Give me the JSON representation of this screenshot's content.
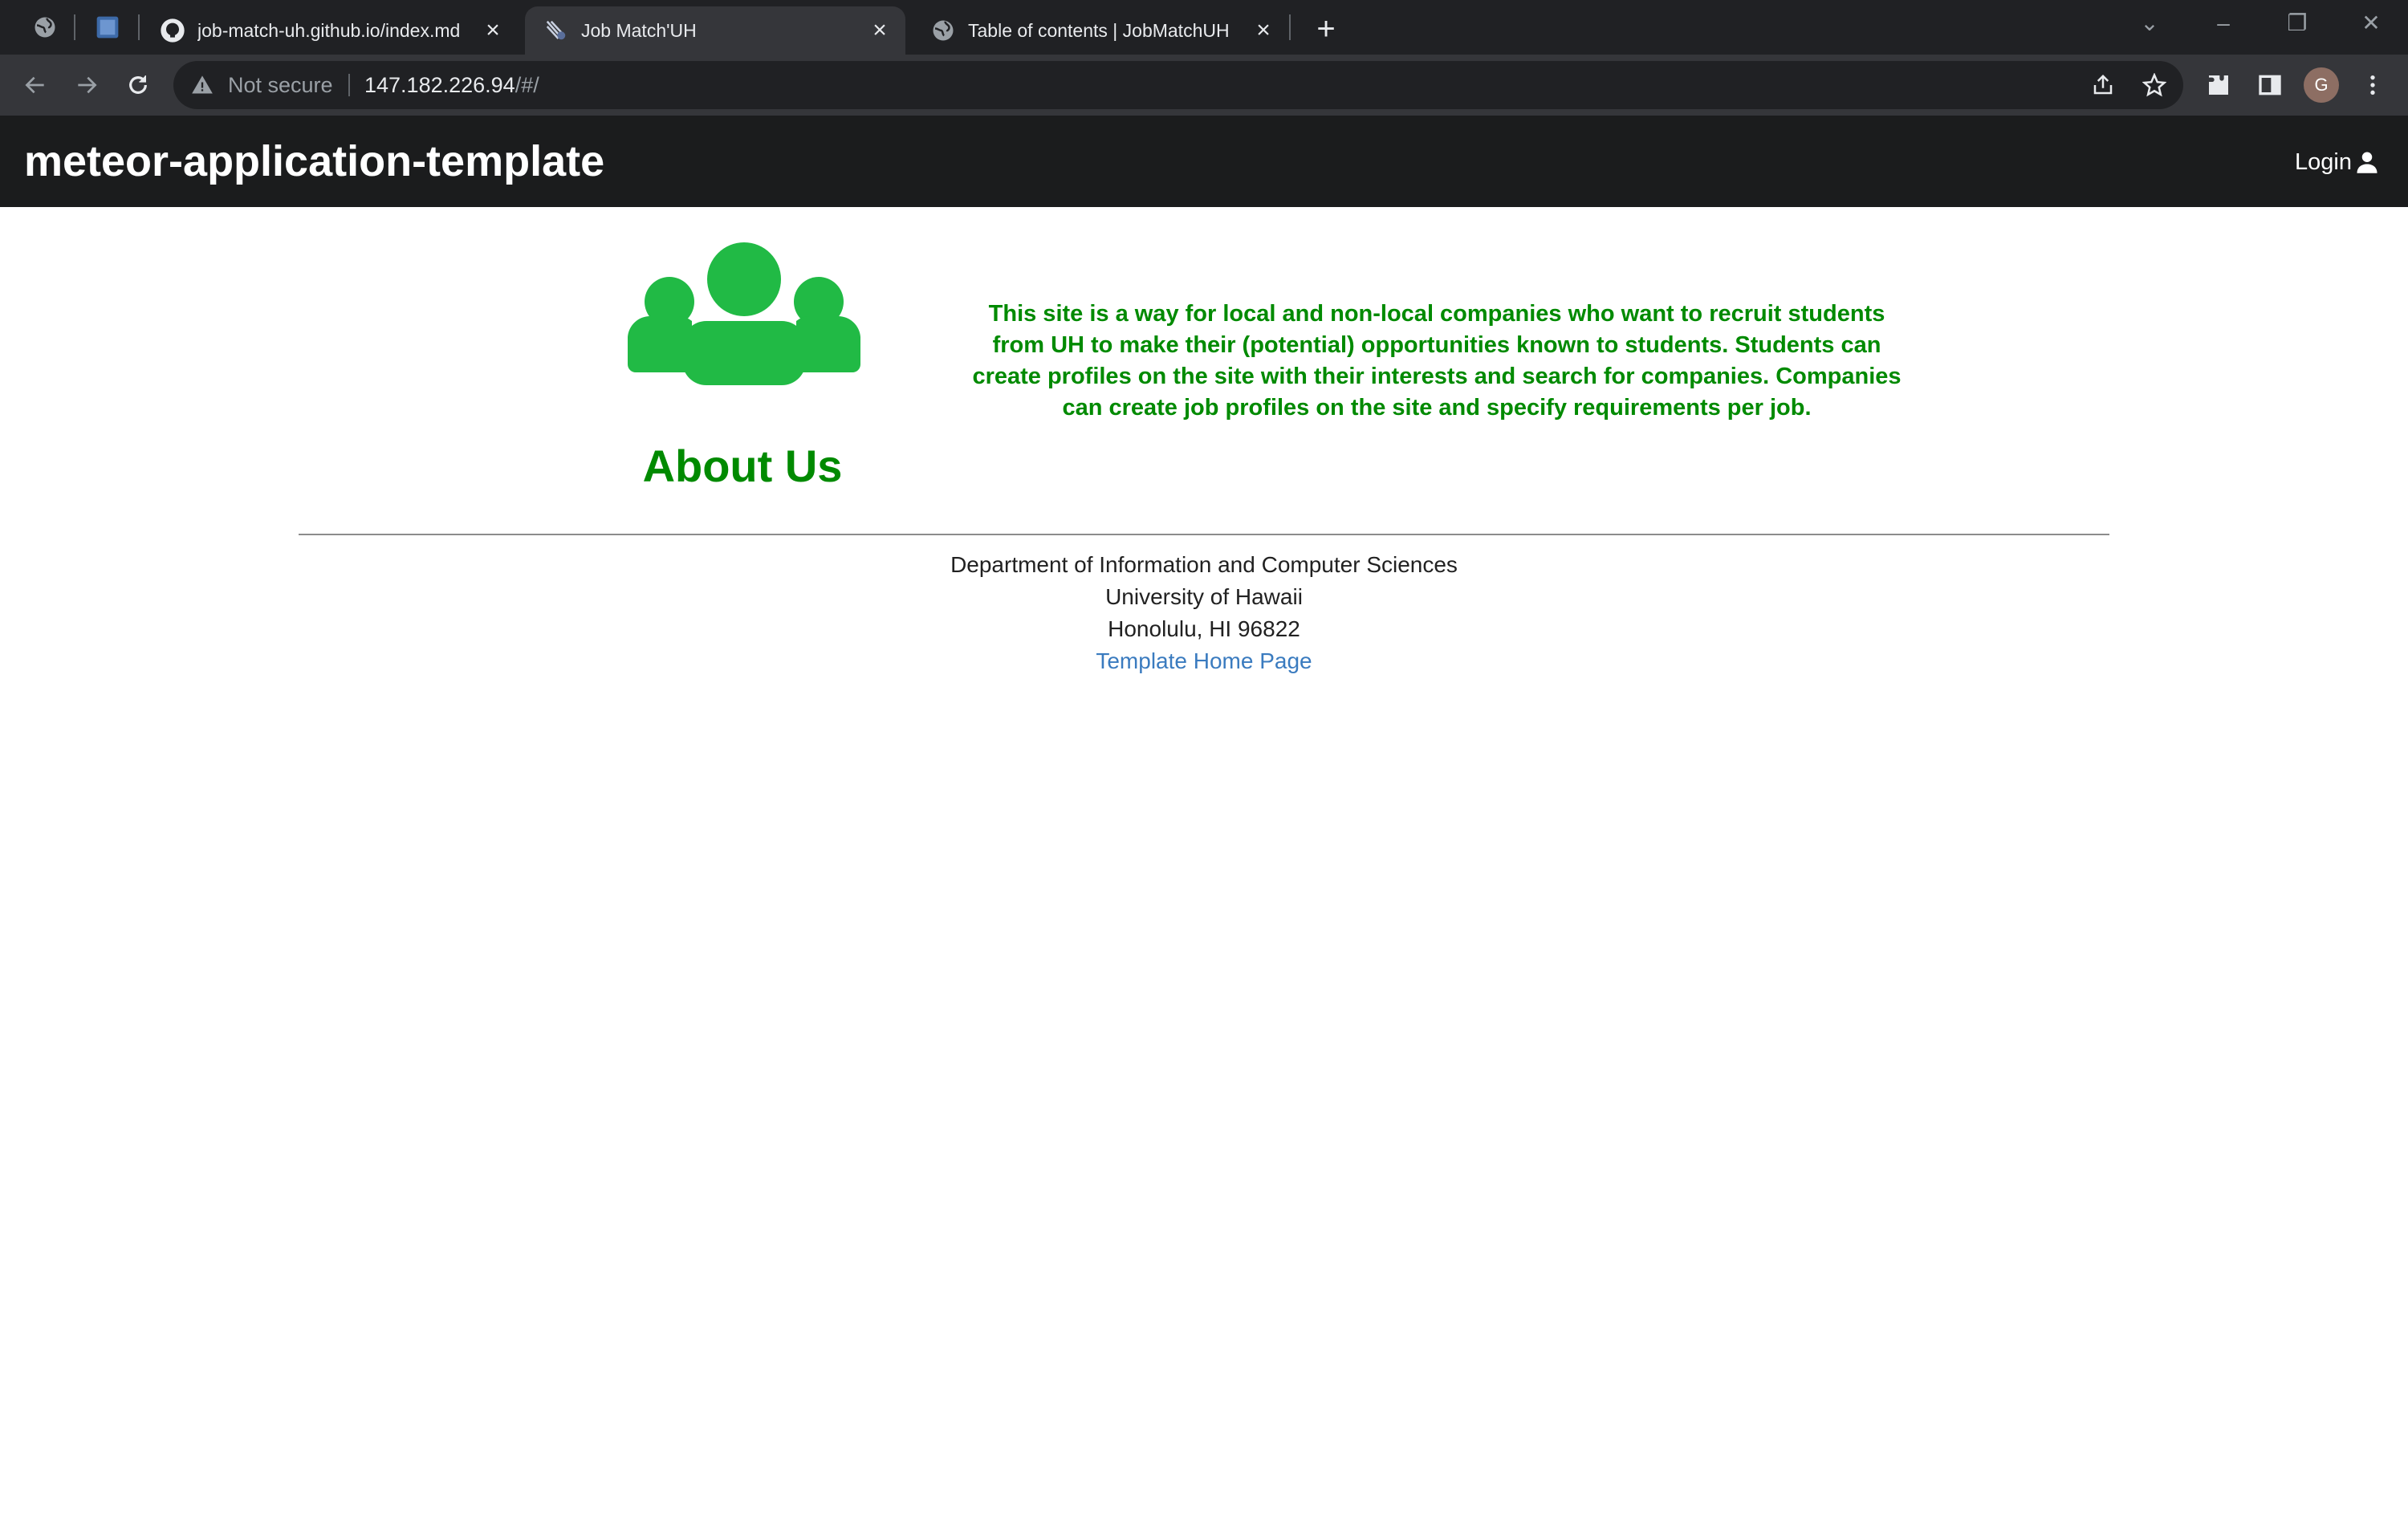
{
  "browser": {
    "tabs": [
      {
        "title": "job-match-uh.github.io/index.md",
        "active": false
      },
      {
        "title": "Job Match'UH",
        "active": true
      },
      {
        "title": "Table of contents | JobMatchUH",
        "active": false
      }
    ],
    "omnibox": {
      "security_label": "Not secure",
      "url_host": "147.182.226.94",
      "url_path": "/#/"
    },
    "profile_initial": "G"
  },
  "navbar": {
    "brand": "meteor-application-template",
    "login_label": "Login"
  },
  "about": {
    "heading": "About Us",
    "icon": "users-icon",
    "description": "This site is a way for local and non-local companies who want to recruit students from UH to make their (potential) opportunities known to students. Students can create profiles on the site with their interests and search for companies. Companies can create job profiles on the site and specify requirements per job."
  },
  "footer": {
    "line1": "Department of Information and Computer Sciences",
    "line2": "University of Hawaii",
    "line3": "Honolulu, HI 96822",
    "link_label": "Template Home Page"
  },
  "colors": {
    "accent_green": "#008a00",
    "icon_green": "#21ba45",
    "navbar_bg": "#1b1c1d",
    "link_blue": "#3a7bbf"
  }
}
